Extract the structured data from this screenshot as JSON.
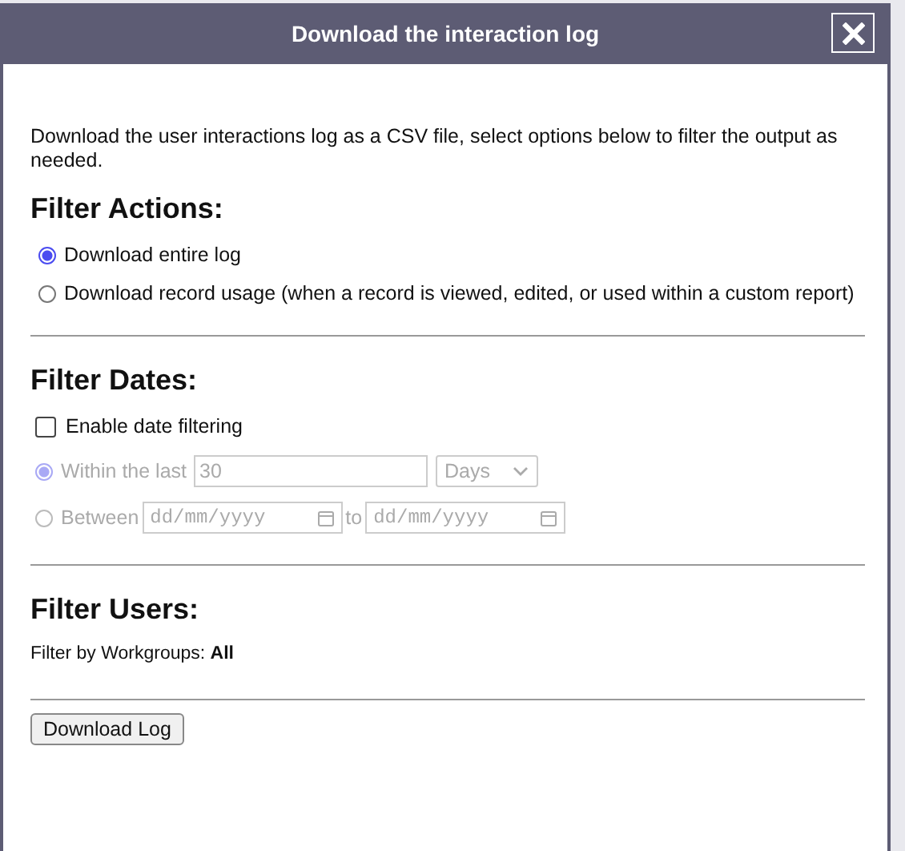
{
  "window": {
    "title": "Download the interaction log"
  },
  "intro": "Download the user interactions log as a CSV file, select options below to filter the output as needed.",
  "filter_actions": {
    "heading": "Filter Actions:",
    "options": [
      {
        "label": "Download entire log",
        "selected": true
      },
      {
        "label": "Download record usage (when a record is viewed, edited, or used within a custom report)",
        "selected": false
      }
    ]
  },
  "filter_dates": {
    "heading": "Filter Dates:",
    "enable": {
      "label": "Enable date filtering",
      "checked": false
    },
    "options": [
      {
        "kind": "within",
        "label": "Within the last",
        "selected": true,
        "disabled": true,
        "value": "30",
        "unit": "Days"
      },
      {
        "kind": "between",
        "label": "Between",
        "selected": false,
        "disabled": true,
        "from_placeholder": "dd/mm/yyyy",
        "connector": "to",
        "to_placeholder": "dd/mm/yyyy"
      }
    ]
  },
  "filter_users": {
    "heading": "Filter Users:",
    "text": "Filter by Workgroups: **All**"
  },
  "button": "Download Log"
}
